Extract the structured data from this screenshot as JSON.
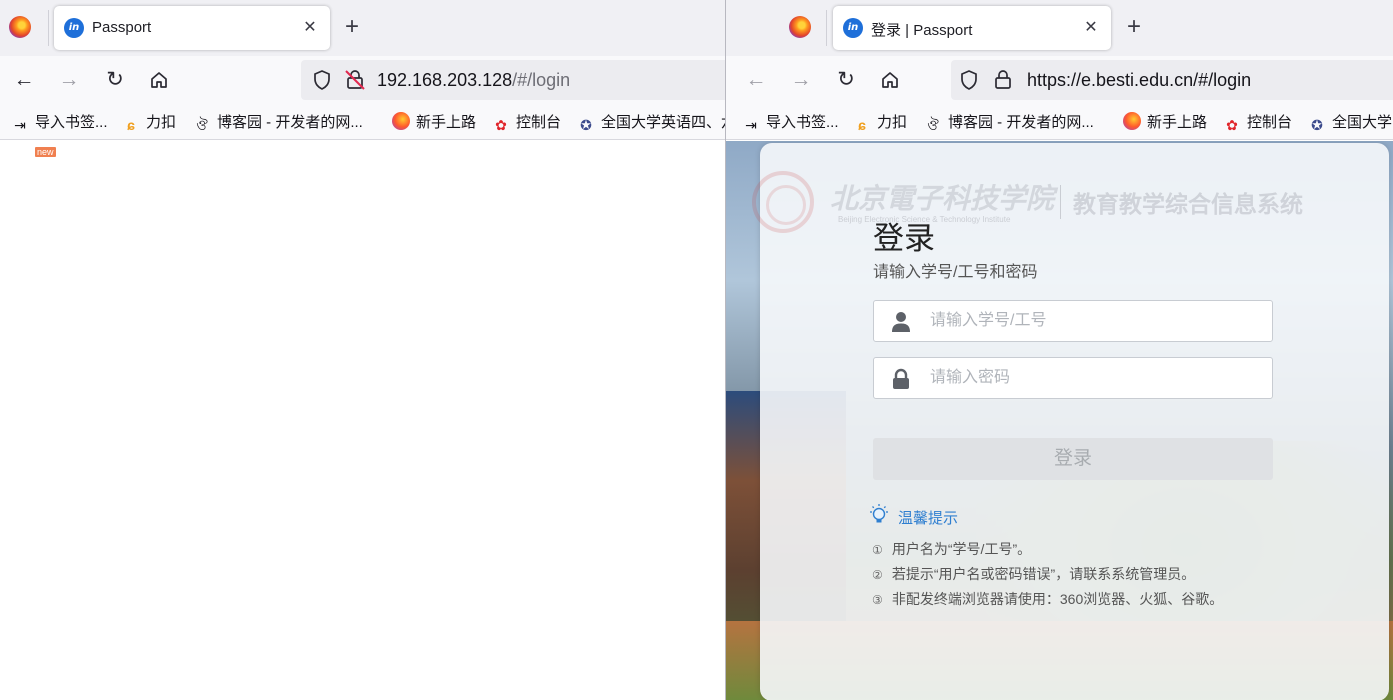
{
  "left_window": {
    "tab_title": "Passport",
    "url_main": "192.168.203.128",
    "url_path": "/#/login",
    "new_badge": "new"
  },
  "right_window": {
    "tab_title": "登录 | Passport",
    "url": "https://e.besti.edu.cn/#/login"
  },
  "bookmarks": [
    {
      "label": "导入书签...",
      "icon": "import-icon"
    },
    {
      "label": "力扣",
      "icon": "leetcode-icon"
    },
    {
      "label": "博客园 - 开发者的网...",
      "icon": "cnblogs-icon"
    },
    {
      "label": "新手上路",
      "icon": "firefox-icon"
    },
    {
      "label": "控制台",
      "icon": "huawei-icon"
    },
    {
      "label": "全国大学英语四、六...",
      "icon": "cet-icon"
    }
  ],
  "right_bookmarks": [
    {
      "label": "导入书签..."
    },
    {
      "label": "力扣"
    },
    {
      "label": "博客园 - 开发者的网..."
    },
    {
      "label": "新手上路"
    },
    {
      "label": "控制台"
    },
    {
      "label": "全国大学"
    }
  ],
  "login": {
    "school_name": "北京電子科技学院",
    "school_sub": "Beijing Electronic Science & Technology Institute",
    "system_name": "教育教学综合信息系统",
    "title": "登录",
    "subtitle": "请输入学号/工号和密码",
    "username_placeholder": "请输入学号/工号",
    "password_placeholder": "请输入密码",
    "button_label": "登录",
    "tips_title": "温馨提示",
    "tips": [
      {
        "num": "①",
        "text": "用户名为“学号/工号”。"
      },
      {
        "num": "②",
        "text": "若提示“用户名或密码错误”，请联系系统管理员。"
      },
      {
        "num": "③",
        "text": "非配发终端浏览器请使用：360浏览器、火狐、谷歌。"
      }
    ]
  },
  "colors": {
    "tips_blue": "#2f7fd0",
    "favicon_blue": "#1e6fd9",
    "disabled_button": "#dfe1e4"
  }
}
